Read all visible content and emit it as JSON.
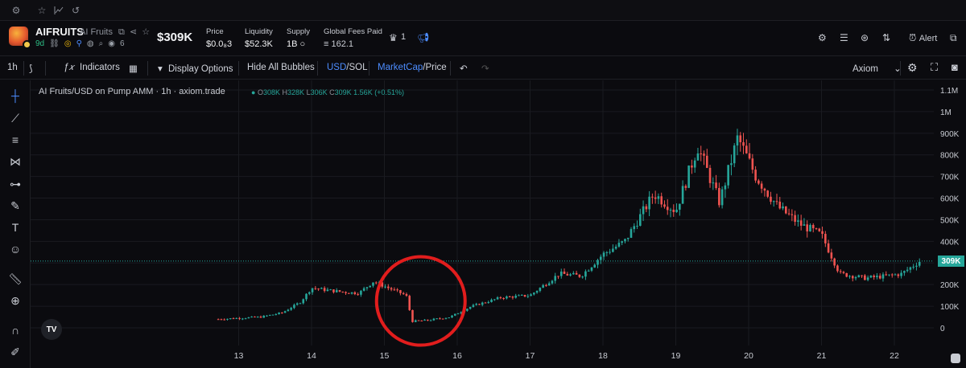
{
  "header": {
    "ticker": "AIFRUITS",
    "token_name": "AI Fruits",
    "age": "9d",
    "holders_count": "6",
    "market_cap": "$309K",
    "stats": [
      {
        "label": "Price",
        "value": "$0.0₈3"
      },
      {
        "label": "Liquidity",
        "value": "$52.3K"
      },
      {
        "label": "Supply",
        "value": "1B ○"
      },
      {
        "label": "Global Fees Paid",
        "value": "≡ 162.1"
      }
    ],
    "badge_count": "1",
    "alert_label": "Alert"
  },
  "toolbar": {
    "interval": "1h",
    "indicators": "Indicators",
    "display_options": "Display Options",
    "hide_bubbles": "Hide All Bubbles",
    "usd": "USD",
    "sol": "/SOL",
    "marketcap": "MarketCap",
    "price": "/Price",
    "source": "Axiom"
  },
  "legend": {
    "title": "AI Fruits/USD on Pump AMM · 1h · axiom.trade",
    "o_label": "O",
    "o_value": "308K",
    "h_label": "H",
    "h_value": "328K",
    "l_label": "L",
    "l_value": "306K",
    "c_label": "C",
    "c_value": "309K",
    "change": "1.56K (+0.51%)"
  },
  "colors": {
    "up": "#26a69a",
    "down": "#ef5350",
    "circle": "#e11d1d",
    "grid": "#1a1b20"
  },
  "chart_data": {
    "type": "candlestick",
    "x_tick_labels": [
      "13",
      "14",
      "15",
      "16",
      "17",
      "18",
      "19",
      "20",
      "21",
      "22"
    ],
    "y_tick_labels": [
      "1.1M",
      "1M",
      "900K",
      "800K",
      "700K",
      "600K",
      "500K",
      "400K",
      "300K",
      "200K",
      "100K",
      "0"
    ],
    "ylim": [
      0,
      1100000
    ],
    "last_value_label": "309K",
    "last_value": 309000,
    "annotation": {
      "shape": "circle",
      "color": "#e11d1d",
      "center_day": 15.5,
      "center_value": 50000
    },
    "close_path": [
      {
        "day": 12.72,
        "close": 40000
      },
      {
        "day": 13.0,
        "close": 45000
      },
      {
        "day": 13.3,
        "close": 50000
      },
      {
        "day": 13.6,
        "close": 70000
      },
      {
        "day": 13.85,
        "close": 120000
      },
      {
        "day": 14.0,
        "close": 185000
      },
      {
        "day": 14.2,
        "close": 175000
      },
      {
        "day": 14.45,
        "close": 165000
      },
      {
        "day": 14.65,
        "close": 160000
      },
      {
        "day": 14.85,
        "close": 215000
      },
      {
        "day": 15.05,
        "close": 185000
      },
      {
        "day": 15.3,
        "close": 150000
      },
      {
        "day": 15.38,
        "close": 30000
      },
      {
        "day": 15.6,
        "close": 35000
      },
      {
        "day": 15.9,
        "close": 50000
      },
      {
        "day": 16.2,
        "close": 100000
      },
      {
        "day": 16.6,
        "close": 140000
      },
      {
        "day": 17.0,
        "close": 150000
      },
      {
        "day": 17.4,
        "close": 250000
      },
      {
        "day": 17.7,
        "close": 240000
      },
      {
        "day": 18.0,
        "close": 340000
      },
      {
        "day": 18.3,
        "close": 400000
      },
      {
        "day": 18.7,
        "close": 620000
      },
      {
        "day": 19.0,
        "close": 540000
      },
      {
        "day": 19.3,
        "close": 840000
      },
      {
        "day": 19.6,
        "close": 580000
      },
      {
        "day": 19.85,
        "close": 880000
      },
      {
        "day": 20.1,
        "close": 700000
      },
      {
        "day": 20.4,
        "close": 560000
      },
      {
        "day": 20.7,
        "close": 480000
      },
      {
        "day": 21.0,
        "close": 430000
      },
      {
        "day": 21.25,
        "close": 250000
      },
      {
        "day": 21.6,
        "close": 230000
      },
      {
        "day": 21.9,
        "close": 240000
      },
      {
        "day": 22.1,
        "close": 250000
      },
      {
        "day": 22.35,
        "close": 309000
      }
    ]
  }
}
